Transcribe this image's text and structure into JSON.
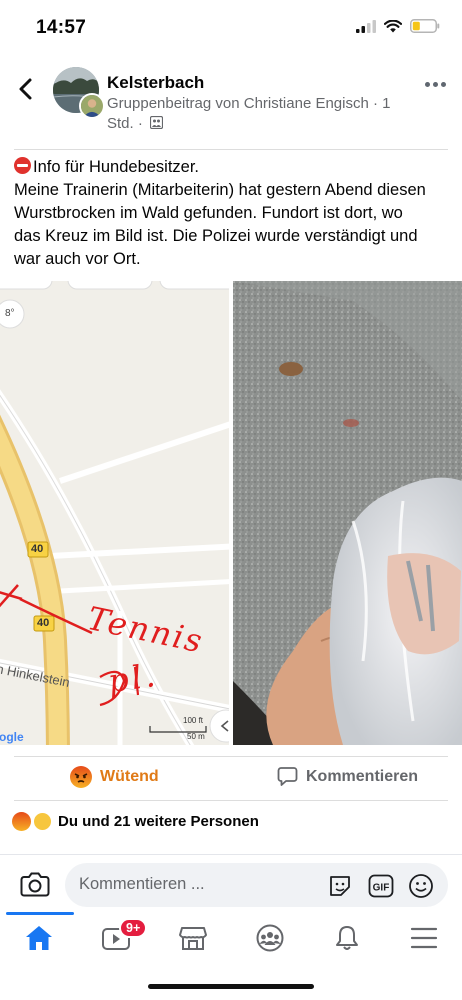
{
  "status_bar": {
    "time": "14:57"
  },
  "header": {
    "group_name": "Kelsterbach",
    "meta_line1": "Gruppenbeitrag von Christiane Engisch · 1",
    "meta_line2": "Std. ·"
  },
  "post": {
    "line1": "Info für Hundebesitzer.",
    "line2": "Meine Trainerin (Mitarbeiterin) hat gestern Abend diesen",
    "line3": "Wurstbrocken im Wald gefunden.  Fundort ist dort, wo",
    "line4": "das Kreuz im Bild ist. Die Polizei wurde verständigt und",
    "line5": "war auch vor Ort."
  },
  "map_photo": {
    "temperature": "8°",
    "road_number_1": "40",
    "road_number_2": "40",
    "street_name": "n Hinkelstein",
    "scale_ft": "100 ft",
    "scale_m": "50 m",
    "logo": "ogle",
    "handwriting_1": "Tennis",
    "handwriting_2": "pl."
  },
  "actions": {
    "react_label": "Wütend",
    "comment_label": "Kommentieren"
  },
  "reactions": {
    "summary": "Du und 21 weitere Personen"
  },
  "comment_bar": {
    "placeholder": "Kommentieren ..."
  },
  "tabs": {
    "video_badge": "9+"
  },
  "colors": {
    "accent": "#1877f2",
    "angry": "#e07a16",
    "badge": "#e41e3f"
  },
  "icons": [
    "back-arrow-icon",
    "more-icon",
    "group-privacy-icon",
    "angry-emoji-icon",
    "comment-icon",
    "camera-icon",
    "sticker-icon",
    "gif-icon",
    "emoji-icon",
    "home-icon",
    "video-icon",
    "marketplace-icon",
    "groups-icon",
    "bell-icon",
    "menu-icon"
  ]
}
